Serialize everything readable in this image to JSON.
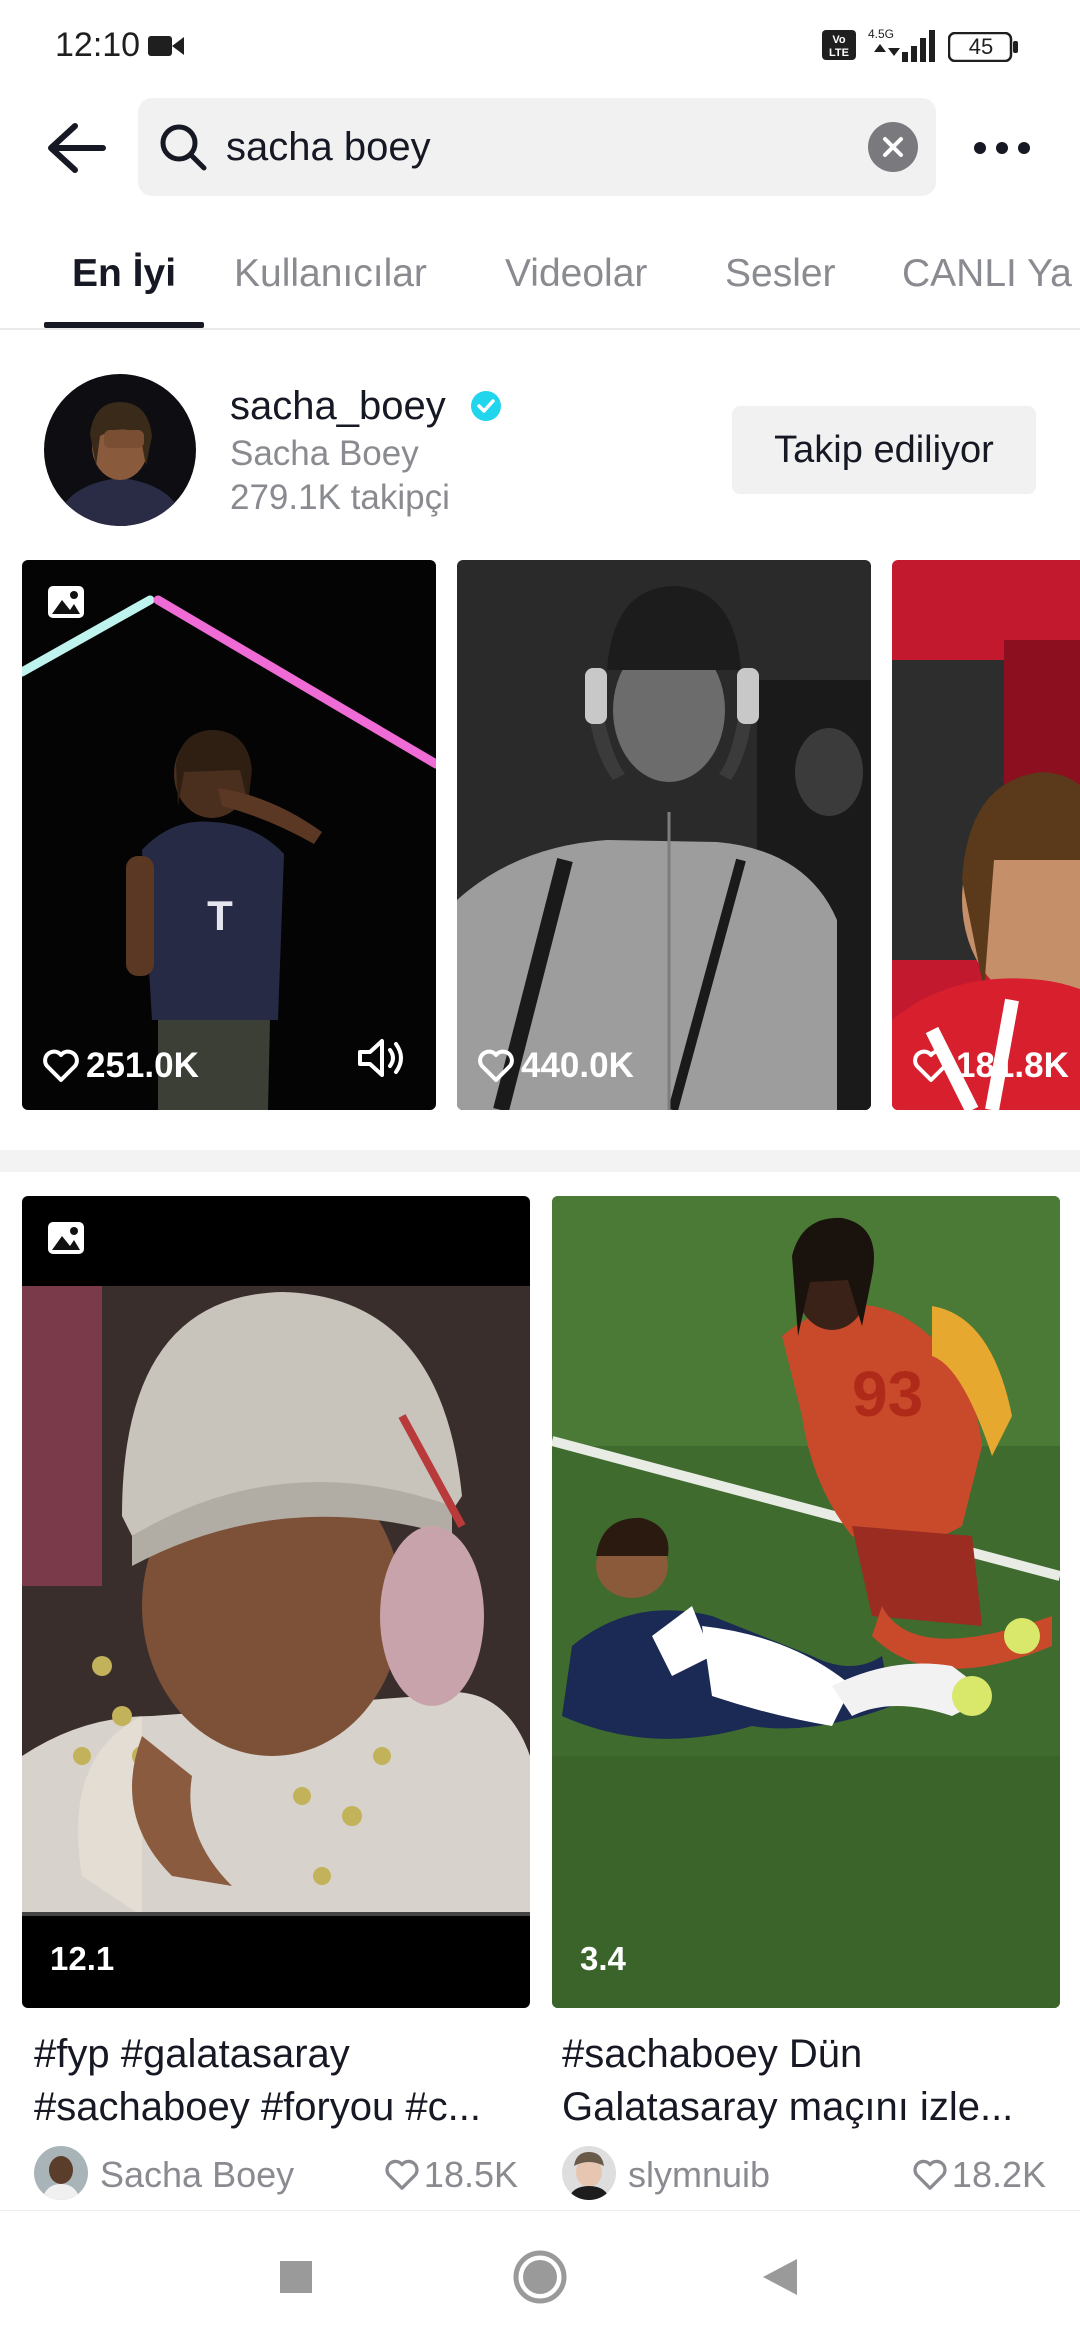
{
  "status_bar": {
    "time": "12:10",
    "battery": "45",
    "network": "4.5G",
    "volte": "Vo LTE"
  },
  "search": {
    "query": "sacha boey"
  },
  "tabs": [
    {
      "label": "En İyi",
      "active": true
    },
    {
      "label": "Kullanıcılar",
      "active": false
    },
    {
      "label": "Videolar",
      "active": false
    },
    {
      "label": "Sesler",
      "active": false
    },
    {
      "label": "CANLI Ya",
      "active": false
    }
  ],
  "user": {
    "username": "sacha_boey",
    "display_name": "Sacha Boey",
    "followers": "279.1K takipçi",
    "follow_label": "Takip ediliyor",
    "verified": true
  },
  "carousel": [
    {
      "likes": "251.0K",
      "type": "photo",
      "sound": true
    },
    {
      "likes": "440.0K",
      "type": "video",
      "sound": false
    },
    {
      "likes": "181.8K",
      "type": "video",
      "sound": false
    }
  ],
  "grid": [
    {
      "duration": "12.1",
      "caption_line1": "#fyp #galatasaray",
      "caption_line2": "#sachaboey #foryou #c...",
      "author": "Sacha Boey",
      "likes": "18.5K"
    },
    {
      "duration": "3.4",
      "caption_line1": "#sachaboey Dün",
      "caption_line2": "Galatasaray maçını izle...",
      "author": "slymnuib",
      "likes": "18.2K"
    }
  ],
  "colors": {
    "accent": "#20d5ec",
    "verified": "#20d5ec",
    "text": "#161823",
    "muted": "#8a8b91"
  }
}
